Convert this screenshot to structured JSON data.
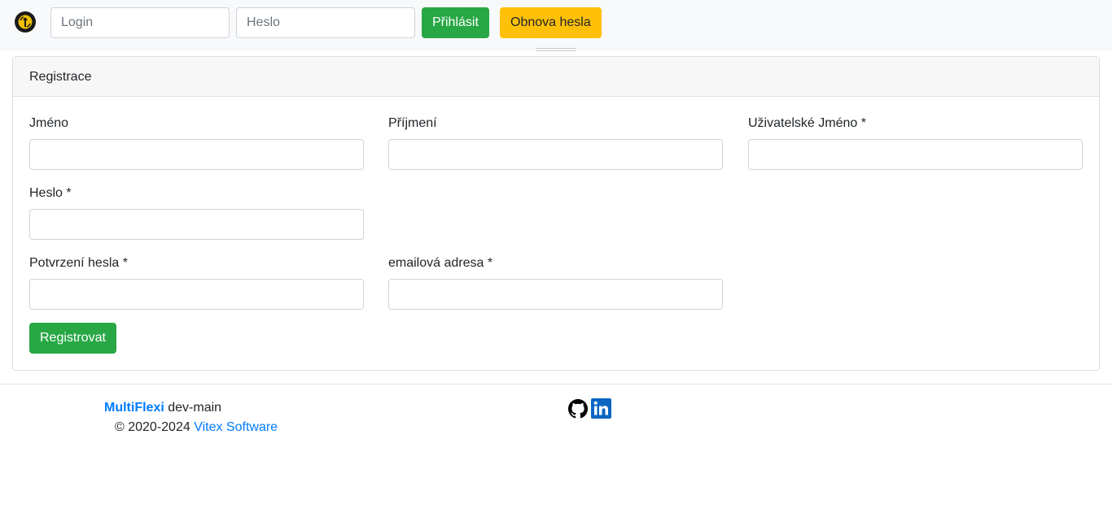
{
  "header": {
    "logo": "app-logo",
    "login_placeholder": "Login",
    "password_placeholder": "Heslo",
    "login_button": "Přihlásit",
    "reset_button": "Obnova hesla"
  },
  "registration": {
    "title": "Registrace",
    "fields": {
      "first_name": "Jméno",
      "last_name": "Příjmení",
      "username": "Uživatelské Jméno *",
      "password": "Heslo *",
      "password_confirm": "Potvrzení hesla *",
      "email": "emailová adresa *"
    },
    "submit": "Registrovat"
  },
  "footer": {
    "brand": "MultiFlexi",
    "version": "dev-main",
    "copyright": "© 2020-2024",
    "company": "Vitex Software",
    "icons": [
      "github-icon",
      "linkedin-icon"
    ]
  },
  "colors": {
    "success": "#28a745",
    "warning": "#ffc107",
    "link": "#007bff"
  }
}
